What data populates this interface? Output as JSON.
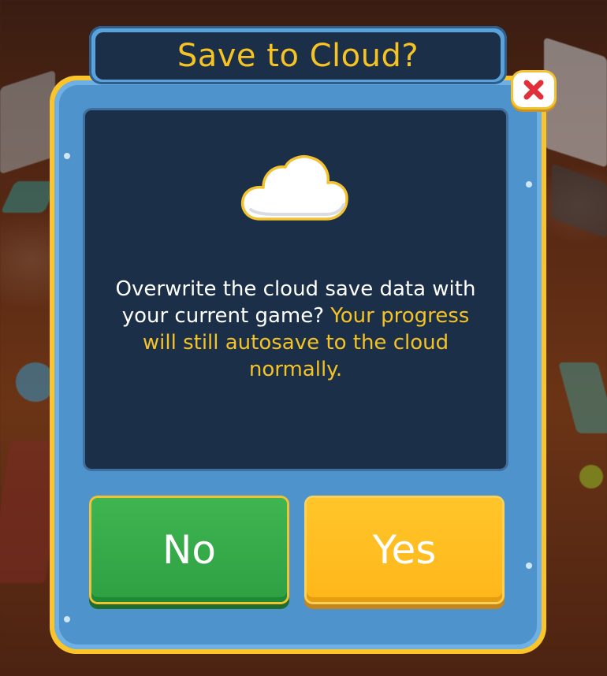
{
  "dialog": {
    "title": "Save to Cloud?",
    "message_main": "Overwrite the cloud save data with your current game? ",
    "message_highlight": "Your progress will still autosave to the cloud normally.",
    "buttons": {
      "no_label": "No",
      "yes_label": "Yes"
    },
    "icons": {
      "cloud": "cloud-icon",
      "close": "close-icon"
    }
  },
  "colors": {
    "title_text": "#f6c325",
    "panel_border": "#fbc42b",
    "panel_fill": "#4f93cd",
    "content_bg": "#1b2f48",
    "highlight_text": "#f6c325",
    "no_button": "#2ea043",
    "yes_button": "#ffb71a",
    "close_x": "#e0303a"
  }
}
